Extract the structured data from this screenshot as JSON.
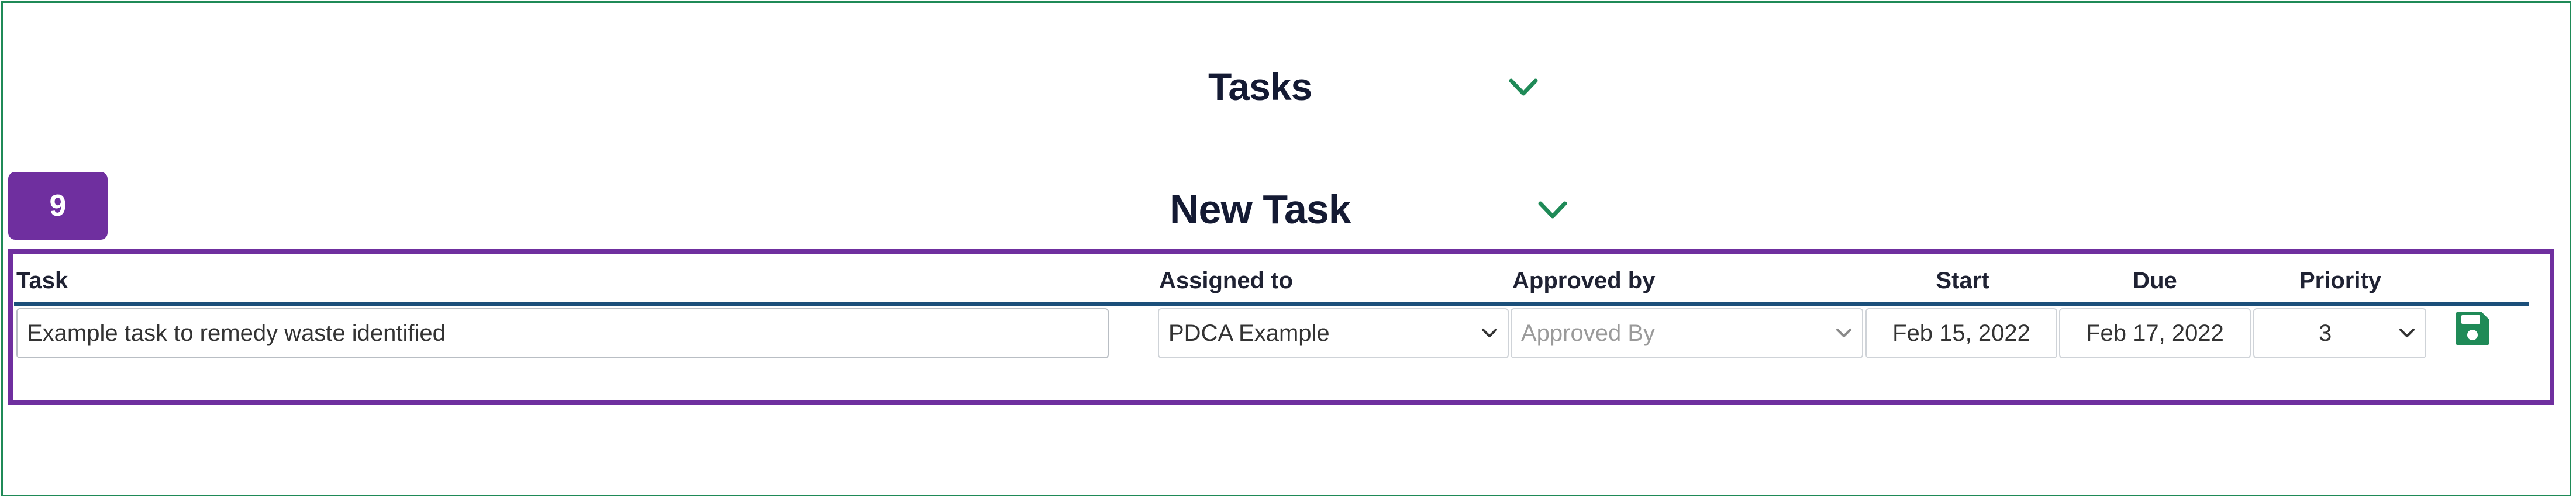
{
  "sections": {
    "tasks_title": "Tasks",
    "new_task_title": "New Task"
  },
  "step_badge": "9",
  "columns": {
    "task": "Task",
    "assigned_to": "Assigned to",
    "approved_by": "Approved by",
    "start": "Start",
    "due": "Due",
    "priority": "Priority"
  },
  "form": {
    "task_value": "Example task to remedy waste identified",
    "assigned_to_value": "PDCA Example",
    "approved_by_placeholder": "Approved By",
    "start_value": "Feb 15, 2022",
    "due_value": "Feb 17, 2022",
    "priority_value": "3"
  },
  "icons": {
    "collapse": "chevron-down-icon",
    "save": "save-icon",
    "select": "caret-down-icon"
  },
  "colors": {
    "frame_border": "#1f8a57",
    "accent_purple": "#6f2f9f",
    "header_rule": "#1b4f7a",
    "chevron_green": "#1f8a57",
    "save_green": "#1f8a57"
  }
}
